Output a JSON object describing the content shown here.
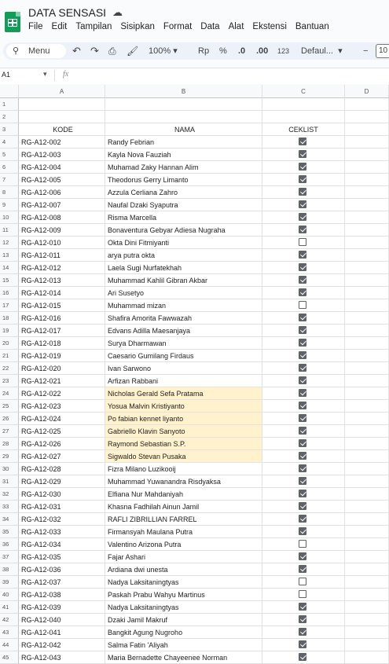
{
  "app": {
    "title": "DATA SENSASI",
    "menu": [
      "File",
      "Edit",
      "Tampilan",
      "Sisipkan",
      "Format",
      "Data",
      "Alat",
      "Ekstensi",
      "Bantuan"
    ]
  },
  "toolbar": {
    "menu_label": "Menu",
    "zoom": "100%",
    "currency": "Rp",
    "percent": "%",
    "dec_decrease": ".0",
    "dec_increase": ".00",
    "number_format": "123",
    "font": "Defaul...",
    "font_size": "10"
  },
  "formula_bar": {
    "cell_ref": "A1",
    "fx": "fx"
  },
  "columns": [
    "A",
    "B",
    "C",
    "D"
  ],
  "header": {
    "row_number": "3",
    "kode": "KODE",
    "nama": "NAMA",
    "ceklist": "CEKLIST"
  },
  "empty_rows": [
    "1",
    "2"
  ],
  "highlight_color": "#fff2cc",
  "rows": [
    {
      "n": "4",
      "kode": "RG-A12-002",
      "nama": "Randy Febrian",
      "checked": true,
      "hl": false
    },
    {
      "n": "5",
      "kode": "RG-A12-003",
      "nama": "Kayla Nova Fauziah",
      "checked": true,
      "hl": false
    },
    {
      "n": "6",
      "kode": "RG-A12-004",
      "nama": "Muhamad Zaky Hannan Alim",
      "checked": true,
      "hl": false
    },
    {
      "n": "7",
      "kode": "RG-A12-005",
      "nama": "Theodorus Gerry Limanto",
      "checked": true,
      "hl": false
    },
    {
      "n": "8",
      "kode": "RG-A12-006",
      "nama": "Azzula Cerliana Zahro",
      "checked": true,
      "hl": false
    },
    {
      "n": "9",
      "kode": "RG-A12-007",
      "nama": "Naufal Dzaki Syaputra",
      "checked": true,
      "hl": false
    },
    {
      "n": "10",
      "kode": "RG-A12-008",
      "nama": "Risma Marcella",
      "checked": true,
      "hl": false
    },
    {
      "n": "11",
      "kode": "RG-A12-009",
      "nama": "Bonaventura Gebyar Adiesa Nugraha",
      "checked": true,
      "hl": false
    },
    {
      "n": "12",
      "kode": "RG-A12-010",
      "nama": "Okta Dini Fitmiyanti",
      "checked": false,
      "hl": false
    },
    {
      "n": "13",
      "kode": "RG-A12-011",
      "nama": "arya putra okta",
      "checked": true,
      "hl": false
    },
    {
      "n": "14",
      "kode": "RG-A12-012",
      "nama": "Laela Sugi Nurfatekhah",
      "checked": true,
      "hl": false
    },
    {
      "n": "15",
      "kode": "RG-A12-013",
      "nama": "Muhammad Kahlil Gibran Akbar",
      "checked": true,
      "hl": false
    },
    {
      "n": "16",
      "kode": "RG-A12-014",
      "nama": "Ari Susetyo",
      "checked": true,
      "hl": false
    },
    {
      "n": "17",
      "kode": "RG-A12-015",
      "nama": "Muhammad mizan",
      "checked": false,
      "hl": false
    },
    {
      "n": "18",
      "kode": "RG-A12-016",
      "nama": "Shafira Amorita Fawwazah",
      "checked": true,
      "hl": false
    },
    {
      "n": "19",
      "kode": "RG-A12-017",
      "nama": "Edvans Adilla Maesanjaya",
      "checked": true,
      "hl": false
    },
    {
      "n": "20",
      "kode": "RG-A12-018",
      "nama": "Surya Dharmawan",
      "checked": true,
      "hl": false
    },
    {
      "n": "21",
      "kode": "RG-A12-019",
      "nama": "Caesario Gumilang Firdaus",
      "checked": true,
      "hl": false
    },
    {
      "n": "22",
      "kode": "RG-A12-020",
      "nama": "Ivan Sarwono",
      "checked": true,
      "hl": false
    },
    {
      "n": "23",
      "kode": "RG-A12-021",
      "nama": "Arfizan Rabbani",
      "checked": true,
      "hl": false
    },
    {
      "n": "24",
      "kode": "RG-A12-022",
      "nama": "Nicholas Gerald Sefa Pratama",
      "checked": true,
      "hl": true
    },
    {
      "n": "25",
      "kode": "RG-A12-023",
      "nama": "Yosua Malvin Kristiyanto",
      "checked": true,
      "hl": true
    },
    {
      "n": "26",
      "kode": "RG-A12-024",
      "nama": "Po fabian kennet liyanto",
      "checked": true,
      "hl": true
    },
    {
      "n": "27",
      "kode": "RG-A12-025",
      "nama": "Gabriello Klavin Sanyoto",
      "checked": true,
      "hl": true
    },
    {
      "n": "28",
      "kode": "RG-A12-026",
      "nama": "Raymond Sebastian S.P.",
      "checked": true,
      "hl": true
    },
    {
      "n": "29",
      "kode": "RG-A12-027",
      "nama": "Sigwaldo Stevan Pusaka",
      "checked": true,
      "hl": true
    },
    {
      "n": "30",
      "kode": "RG-A12-028",
      "nama": "Fizra Milano Luzikooij",
      "checked": true,
      "hl": false
    },
    {
      "n": "31",
      "kode": "RG-A12-029",
      "nama": "Muhammad Yuwanandra Risdyaksa",
      "checked": true,
      "hl": false
    },
    {
      "n": "32",
      "kode": "RG-A12-030",
      "nama": "Elfiana Nur Mahdaniyah",
      "checked": true,
      "hl": false
    },
    {
      "n": "33",
      "kode": "RG-A12-031",
      "nama": "Khasna Fadhilah Ainun Jamil",
      "checked": true,
      "hl": false
    },
    {
      "n": "34",
      "kode": "RG-A12-032",
      "nama": "RAFLI ZIBRILLIAN FARREL",
      "checked": true,
      "hl": false
    },
    {
      "n": "35",
      "kode": "RG-A12-033",
      "nama": "Firmansyah Maulana Putra",
      "checked": true,
      "hl": false
    },
    {
      "n": "36",
      "kode": "RG-A12-034",
      "nama": "Valentino Arizona Putra",
      "checked": false,
      "hl": false
    },
    {
      "n": "37",
      "kode": "RG-A12-035",
      "nama": "Fajar Ashari",
      "checked": true,
      "hl": false
    },
    {
      "n": "38",
      "kode": "RG-A12-036",
      "nama": "Ardiana dwi unesta",
      "checked": true,
      "hl": false
    },
    {
      "n": "39",
      "kode": "RG-A12-037",
      "nama": "Nadya Laksitaningtyas",
      "checked": false,
      "hl": false
    },
    {
      "n": "40",
      "kode": "RG-A12-038",
      "nama": "Paskah Prabu Wahyu Martinus",
      "checked": false,
      "hl": false
    },
    {
      "n": "41",
      "kode": "RG-A12-039",
      "nama": "Nadya Laksitaningtyas",
      "checked": true,
      "hl": false
    },
    {
      "n": "42",
      "kode": "RG-A12-040",
      "nama": "Dzaki Jamil Makruf",
      "checked": true,
      "hl": false
    },
    {
      "n": "43",
      "kode": "RG-A12-041",
      "nama": "Bangkit Agung Nugroho",
      "checked": true,
      "hl": false
    },
    {
      "n": "44",
      "kode": "RG-A12-042",
      "nama": "Salma Fatin 'Aliyah",
      "checked": true,
      "hl": false
    },
    {
      "n": "45",
      "kode": "RG-A12-043",
      "nama": "Maria Bernadette Chayeenee Norman",
      "checked": true,
      "hl": false
    }
  ]
}
